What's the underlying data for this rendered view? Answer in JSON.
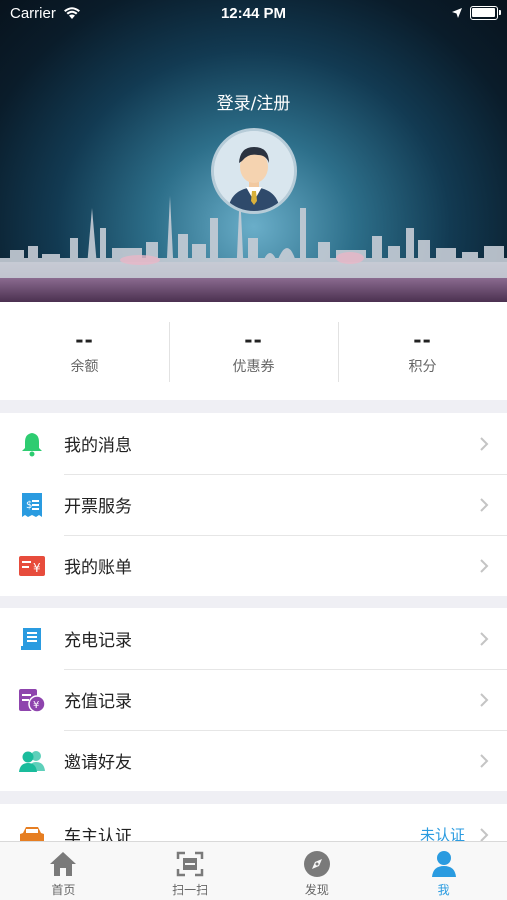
{
  "status_bar": {
    "carrier": "Carrier",
    "time": "12:44 PM"
  },
  "header": {
    "login_label": "登录/注册"
  },
  "stats": [
    {
      "value": "--",
      "label": "余额"
    },
    {
      "value": "--",
      "label": "优惠券"
    },
    {
      "value": "--",
      "label": "积分"
    }
  ],
  "menu_group_1": [
    {
      "label": "我的消息",
      "icon": "bell-icon"
    },
    {
      "label": "开票服务",
      "icon": "invoice-icon"
    },
    {
      "label": "我的账单",
      "icon": "bill-icon"
    }
  ],
  "menu_group_2": [
    {
      "label": "充电记录",
      "icon": "charge-record-icon"
    },
    {
      "label": "充值记录",
      "icon": "recharge-record-icon"
    },
    {
      "label": "邀请好友",
      "icon": "invite-friends-icon"
    }
  ],
  "menu_group_3": [
    {
      "label": "车主认证",
      "icon": "car-icon",
      "status": "未认证"
    }
  ],
  "tabbar": [
    {
      "label": "首页",
      "icon": "home-icon"
    },
    {
      "label": "扫一扫",
      "icon": "scan-icon"
    },
    {
      "label": "发现",
      "icon": "discover-icon"
    },
    {
      "label": "我",
      "icon": "profile-icon",
      "active": true
    }
  ],
  "colors": {
    "accent": "#2a9be0",
    "bell": "#2ecc71",
    "invoice": "#2a9be0",
    "bill": "#e74c3c",
    "recharge": "#8e44ad",
    "invite": "#1abc9c",
    "car": "#e67e22"
  }
}
